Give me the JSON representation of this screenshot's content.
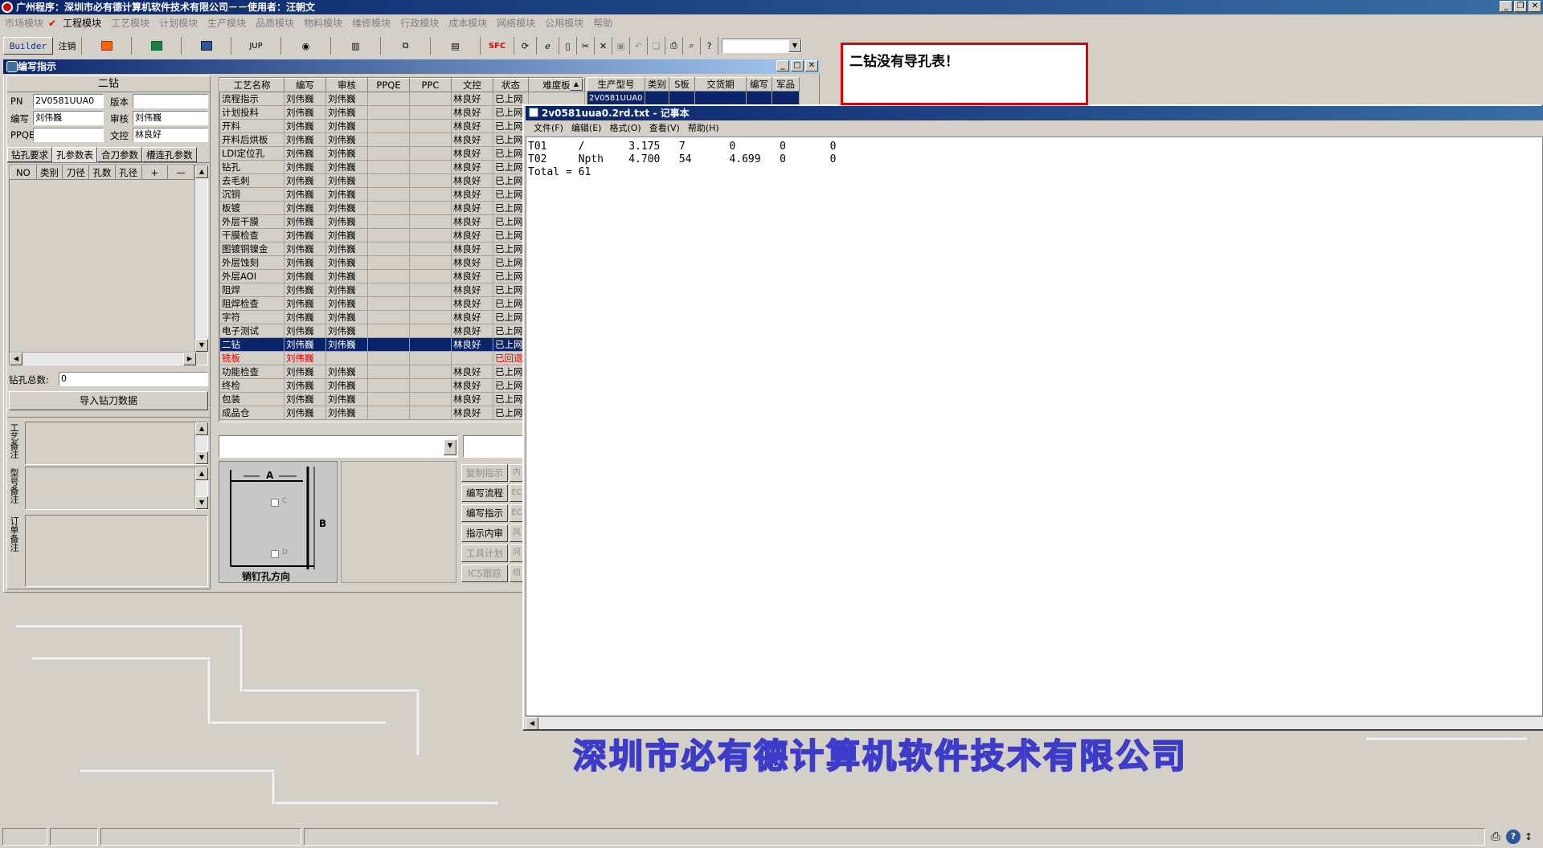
{
  "app": {
    "title": "广州程序：深圳市必有德计算机软件技术有限公司－－使用者：汪朝文"
  },
  "menu": [
    {
      "label": "市场模块",
      "active": false
    },
    {
      "label": "工程模块",
      "active": true
    },
    {
      "label": "工艺模块",
      "active": false
    },
    {
      "label": "计划模块",
      "active": false
    },
    {
      "label": "生产模块",
      "active": false
    },
    {
      "label": "品质模块",
      "active": false
    },
    {
      "label": "物料模块",
      "active": false
    },
    {
      "label": "维修模块",
      "active": false
    },
    {
      "label": "行政模块",
      "active": false
    },
    {
      "label": "成本模块",
      "active": false
    },
    {
      "label": "网络模块",
      "active": false
    },
    {
      "label": "公用模块",
      "active": false
    },
    {
      "label": "帮助",
      "active": false
    }
  ],
  "toolbar": {
    "builder": "Builder",
    "logout": "注销",
    "jup": "JUP",
    "spc": "SFC"
  },
  "child_window": {
    "title": "编写指示"
  },
  "left": {
    "heading": "二钻",
    "pn_label": "PN",
    "pn": "2V0581UUA0",
    "version_label": "版本",
    "version": "",
    "writer_label": "编写",
    "writer": "刘伟巍",
    "reviewer_label": "审核",
    "reviewer": "刘伟巍",
    "ppqe_label": "PPQE",
    "ppqe": "",
    "doc_label": "文控",
    "doc": "林良好",
    "tabs": [
      "钻孔要求",
      "孔参数表",
      "合刀参数",
      "槽连孔参数"
    ],
    "hole_headers": [
      "NO",
      "类别",
      "刀径",
      "孔数",
      "孔径",
      "+",
      "—"
    ],
    "total_label": "钻孔总数:",
    "total": "0",
    "import_btn": "导入钻刀数据",
    "note1": "工艺备注",
    "note2": "型号备注",
    "note3": "订单备注"
  },
  "process": {
    "headers": [
      "工艺名称",
      "编写",
      "审核",
      "PPQE",
      "PPC",
      "文控",
      "状态",
      "难度板"
    ],
    "rows": [
      [
        "流程指示",
        "刘伟巍",
        "刘伟巍",
        "",
        "",
        "林良好",
        "已上网"
      ],
      [
        "计划投料",
        "刘伟巍",
        "刘伟巍",
        "",
        "",
        "林良好",
        "已上网"
      ],
      [
        "开料",
        "刘伟巍",
        "刘伟巍",
        "",
        "",
        "林良好",
        "已上网"
      ],
      [
        "开料后烘板",
        "刘伟巍",
        "刘伟巍",
        "",
        "",
        "林良好",
        "已上网"
      ],
      [
        "LDI定位孔",
        "刘伟巍",
        "刘伟巍",
        "",
        "",
        "林良好",
        "已上网"
      ],
      [
        "钻孔",
        "刘伟巍",
        "刘伟巍",
        "",
        "",
        "林良好",
        "已上网"
      ],
      [
        "去毛刺",
        "刘伟巍",
        "刘伟巍",
        "",
        "",
        "林良好",
        "已上网"
      ],
      [
        "沉铜",
        "刘伟巍",
        "刘伟巍",
        "",
        "",
        "林良好",
        "已上网"
      ],
      [
        "板镀",
        "刘伟巍",
        "刘伟巍",
        "",
        "",
        "林良好",
        "已上网"
      ],
      [
        "外层干膜",
        "刘伟巍",
        "刘伟巍",
        "",
        "",
        "林良好",
        "已上网"
      ],
      [
        "干膜检查",
        "刘伟巍",
        "刘伟巍",
        "",
        "",
        "林良好",
        "已上网"
      ],
      [
        "图镀铜镍金",
        "刘伟巍",
        "刘伟巍",
        "",
        "",
        "林良好",
        "已上网"
      ],
      [
        "外层蚀刻",
        "刘伟巍",
        "刘伟巍",
        "",
        "",
        "林良好",
        "已上网"
      ],
      [
        "外层AOI",
        "刘伟巍",
        "刘伟巍",
        "",
        "",
        "林良好",
        "已上网"
      ],
      [
        "阻焊",
        "刘伟巍",
        "刘伟巍",
        "",
        "",
        "林良好",
        "已上网"
      ],
      [
        "阻焊检查",
        "刘伟巍",
        "刘伟巍",
        "",
        "",
        "林良好",
        "已上网"
      ],
      [
        "字符",
        "刘伟巍",
        "刘伟巍",
        "",
        "",
        "林良好",
        "已上网"
      ],
      [
        "电子测试",
        "刘伟巍",
        "刘伟巍",
        "",
        "",
        "林良好",
        "已上网"
      ],
      [
        "二钻",
        "刘伟巍",
        "刘伟巍",
        "",
        "",
        "林良好",
        "已上网"
      ],
      [
        "铣板",
        "刘伟巍",
        "",
        "",
        "",
        "",
        "已回退"
      ],
      [
        "功能检查",
        "刘伟巍",
        "刘伟巍",
        "",
        "",
        "林良好",
        "已上网"
      ],
      [
        "终检",
        "刘伟巍",
        "刘伟巍",
        "",
        "",
        "林良好",
        "已上网"
      ],
      [
        "包装",
        "刘伟巍",
        "刘伟巍",
        "",
        "",
        "林良好",
        "已上网"
      ],
      [
        "成品仓",
        "刘伟巍",
        "刘伟巍",
        "",
        "",
        "林良好",
        "已上网"
      ]
    ],
    "selected_row": 18,
    "returned_row": 19
  },
  "product": {
    "headers": [
      "生产型号",
      "类别",
      "S板",
      "交货期",
      "编写",
      "军品"
    ],
    "row": [
      "2V0581UUA0",
      "",
      "",
      "",
      "",
      ""
    ]
  },
  "diagram": {
    "a": "A",
    "b": "B",
    "c": "C",
    "d": "D",
    "caption": "销钉孔方向"
  },
  "buttons": [
    {
      "label": "复制指示",
      "enabled": false,
      "side": "内"
    },
    {
      "label": "编写流程",
      "enabled": true,
      "side": "EC"
    },
    {
      "label": "编写指示",
      "enabled": true,
      "side": "EC"
    },
    {
      "label": "指示内审",
      "enabled": true,
      "side": "风险"
    },
    {
      "label": "工具计划",
      "enabled": false,
      "side": "问"
    },
    {
      "label": "ICS跟踪",
      "enabled": false,
      "side": "组"
    }
  ],
  "notepad": {
    "title": "2v0581uua0.2rd.txt - 记事本",
    "menu": [
      "文件(F)",
      "编辑(E)",
      "格式(O)",
      "查看(V)",
      "帮助(H)"
    ],
    "lines": [
      "T01     /       3.175   7       0       0       0",
      "T02     Npth    4.700   54      4.699   0       0",
      "Total = 61"
    ]
  },
  "alert": {
    "text": "二钻没有导孔表！"
  },
  "watermark": "深圳市必有德计算机软件技术有限公司",
  "colors": {
    "title": "#0a246a",
    "alert_border": "#e00000",
    "watermark": "#3c3cc8"
  }
}
